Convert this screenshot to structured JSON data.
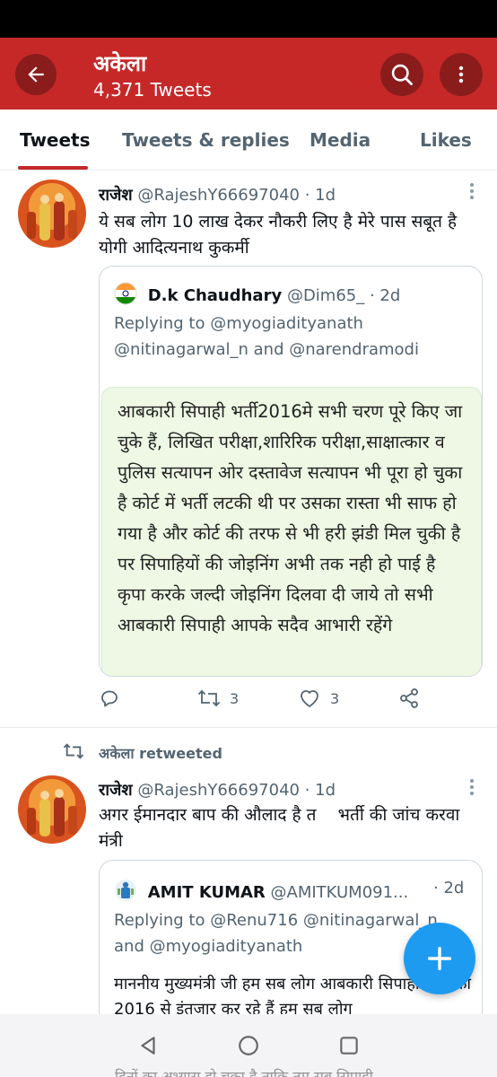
{
  "header": {
    "title": "अकेला",
    "tweet_count": "4,371 Tweets"
  },
  "tabs": [
    "Tweets",
    "Tweets & replies",
    "Media",
    "Likes"
  ],
  "tweets": [
    {
      "display_name": "राजेश",
      "handle": "@RajeshY66697040",
      "time": "· 1d",
      "text": "ये सब लोग 10 लाख देकर नौकरी लिए है मेरे पास सबूत है योगी आदित्यनाथ कुकर्मी",
      "quote": {
        "display_name": "D.k Chaudhary",
        "handle": "@Dim65_",
        "time": "· 2d",
        "replying_prefix": "Replying to",
        "replying_line1": "@myogiadityanath",
        "replying_line2": "@nitinagarwal_n and @narendramodi",
        "image_text": "आबकारी सिपाही भर्ती2016मे सभी चरण पूरे किए जा चुके हैं, लिखित परीक्षा,शारिरिक परीक्षा,साक्षात्कार व पुलिस सत्यापन ओर दस्तावेज सत्यापन भी पूरा हो चुका है कोर्ट में भर्ती लटकी थी पर उसका रास्ता भी साफ हो गया है और कोर्ट की तरफ से भी हरी झंडी मिल चुकी है पर सिपाहियों की जोइनिंग अभी तक नही हो पाई है कृपा करके जल्दी जोइनिंग दिलवा दी जाये तो सभी आबकारी सिपाही आपके सदैव आभारी रहेंगे"
      },
      "retweets": "3",
      "likes": "3"
    },
    {
      "retweeted_by": "अकेला retweeted",
      "display_name": "राजेश",
      "handle": "@RajeshY66697040",
      "time": "· 1d",
      "text": "अगर ईमानदार बाप की औलाद है त    भर्ती की जांच करवा मंत्री",
      "quote": {
        "display_name": "AMIT KUMAR",
        "handle": "@AMITKUM091...",
        "time": "· 2d",
        "replying_line1": "Replying to @Renu716 @nitinagarwal_n",
        "replying_line2": "and @myogiadityanath",
        "body": "माननीय मुख्यमंत्री जी हम सब लोग आबकारी सिपाही भर्ती का 2016 से इंतजार कर रहे हैं हम सब लोग"
      }
    }
  ],
  "navbar_peek": "दिनों का अभ्यास हो चुका है ताकि तुम सब सिपाही"
}
